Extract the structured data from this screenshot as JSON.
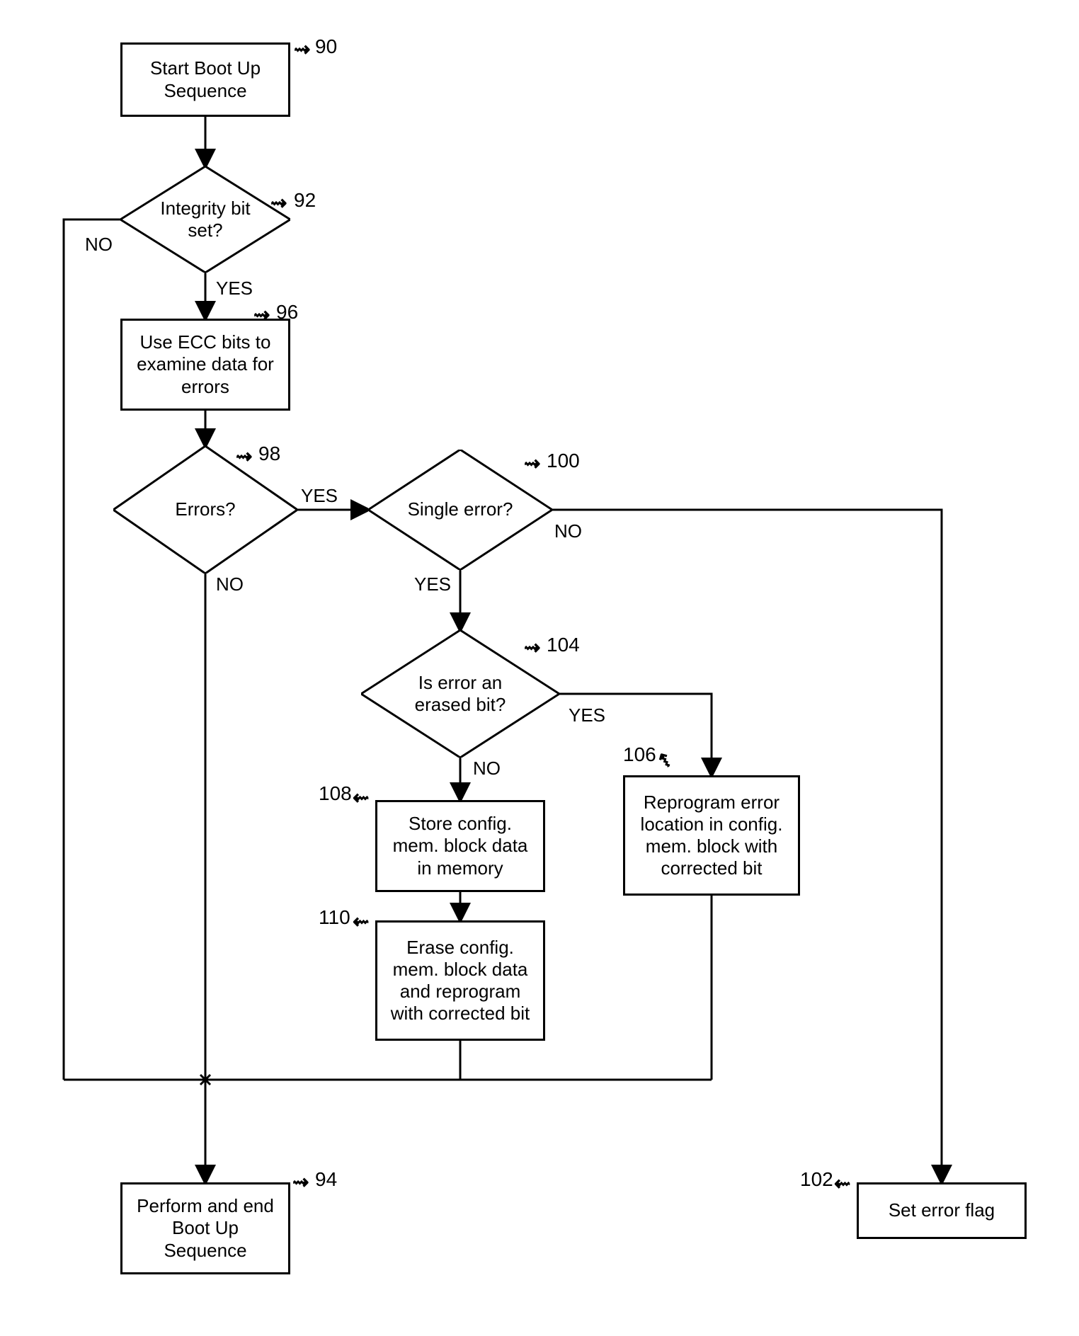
{
  "nodes": {
    "n90": {
      "text": "Start Boot Up\nSequence",
      "ref": "90"
    },
    "n92": {
      "text": "Integrity bit\nset?",
      "ref": "92"
    },
    "n96": {
      "text": "Use ECC bits to\nexamine data for\nerrors",
      "ref": "96"
    },
    "n98": {
      "text": "Errors?",
      "ref": "98"
    },
    "n100": {
      "text": "Single error?",
      "ref": "100"
    },
    "n104": {
      "text": "Is error an\nerased bit?",
      "ref": "104"
    },
    "n108": {
      "text": "Store config.\nmem. block data\nin memory",
      "ref": "108"
    },
    "n110": {
      "text": "Erase config.\nmem. block data\nand reprogram\nwith corrected bit",
      "ref": "110"
    },
    "n106": {
      "text": "Reprogram error\nlocation in config.\nmem. block with\ncorrected bit",
      "ref": "106"
    },
    "n94": {
      "text": "Perform and end\nBoot Up\nSequence",
      "ref": "94"
    },
    "n102": {
      "text": "Set error flag",
      "ref": "102"
    }
  },
  "edges": {
    "yes": "YES",
    "no": "NO"
  }
}
